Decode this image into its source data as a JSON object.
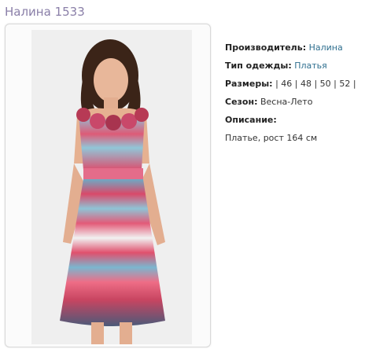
{
  "product": {
    "title": "Налина 1533"
  },
  "details": {
    "manufacturer_label": "Производитель:",
    "manufacturer_value": "Налина",
    "clothing_type_label": "Тип одежды:",
    "clothing_type_value": "Платья",
    "sizes_label": "Размеры:",
    "sizes_value": "| 46 | 48 | 50 | 52 |",
    "season_label": "Сезон:",
    "season_value": "Весна-Лето",
    "description_label": "Описание:",
    "description_value": "Платье, рост 164 см"
  },
  "colors": {
    "title": "#8a7fa8",
    "link": "#2f6f8f"
  }
}
